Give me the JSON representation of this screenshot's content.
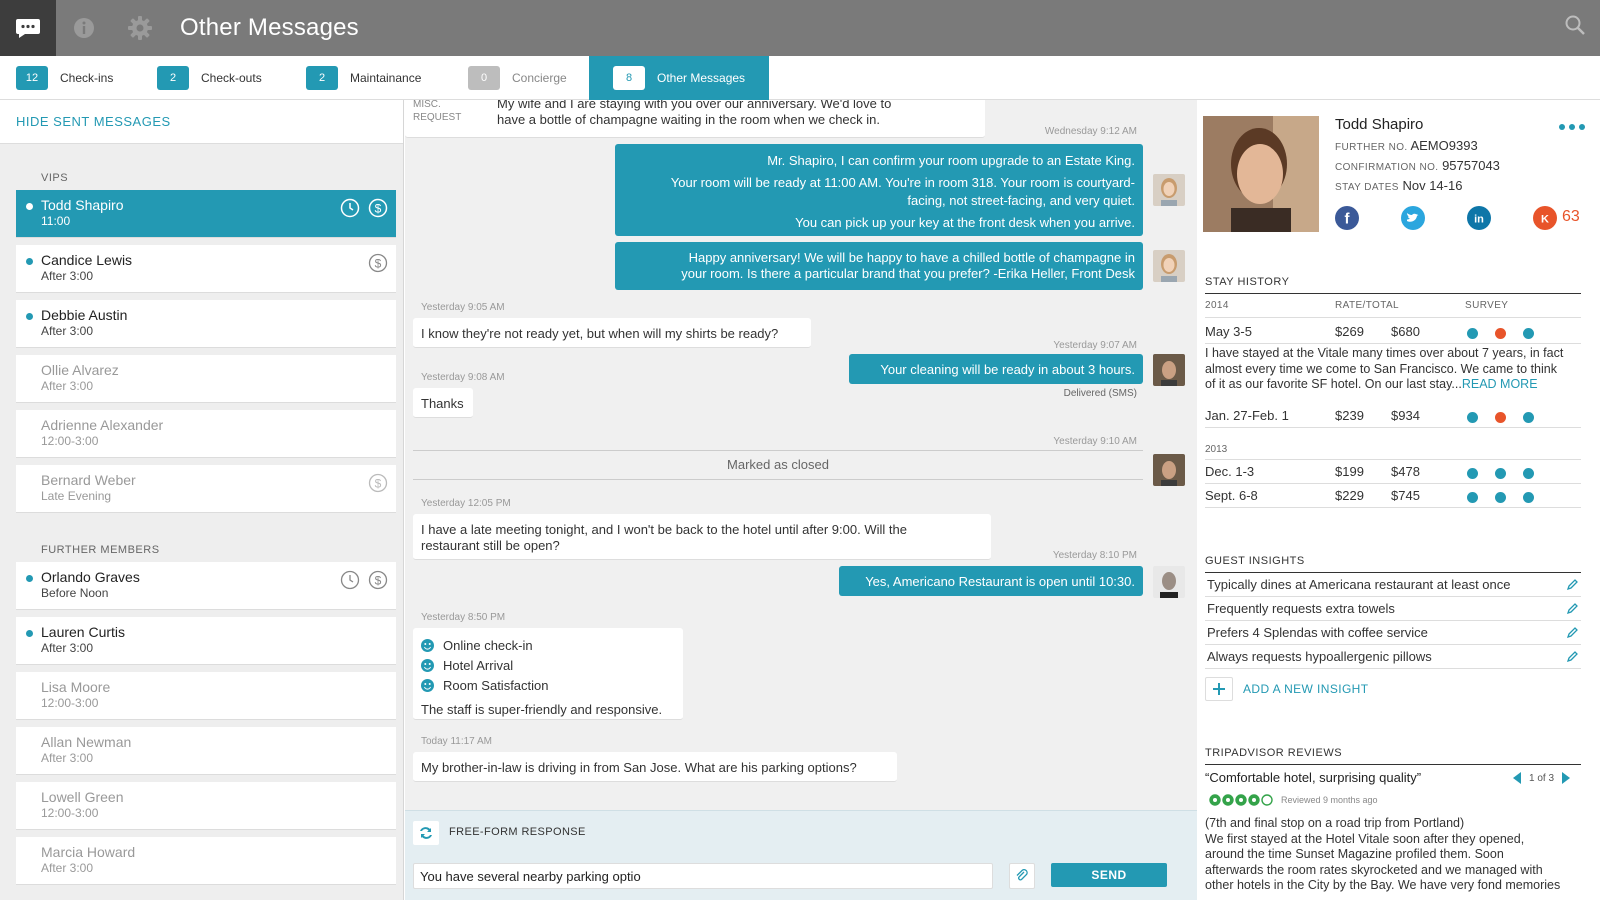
{
  "header": {
    "title": "Other Messages"
  },
  "tabs": [
    {
      "count": "12",
      "label": "Check-ins"
    },
    {
      "count": "2",
      "label": "Check-outs"
    },
    {
      "count": "2",
      "label": "Maintainance"
    },
    {
      "count": "0",
      "label": "Concierge"
    },
    {
      "count": "8",
      "label": "Other Messages"
    }
  ],
  "sidebar": {
    "hide_sent": "HIDE SENT MESSAGES",
    "vips_header": "VIPS",
    "members_header": "FURTHER MEMBERS",
    "vips": [
      {
        "name": "Todd Shapiro",
        "time": "11:00"
      },
      {
        "name": "Candice Lewis",
        "time": "After 3:00"
      },
      {
        "name": "Debbie Austin",
        "time": "After 3:00"
      },
      {
        "name": "Ollie Alvarez",
        "time": "After 3:00"
      },
      {
        "name": "Adrienne Alexander",
        "time": "12:00-3:00"
      },
      {
        "name": "Bernard Weber",
        "time": "Late Evening"
      }
    ],
    "members": [
      {
        "name": "Orlando Graves",
        "time": "Before Noon"
      },
      {
        "name": "Lauren Curtis",
        "time": "After 3:00"
      },
      {
        "name": "Lisa Moore",
        "time": "12:00-3:00"
      },
      {
        "name": "Allan Newman",
        "time": "After 3:00"
      },
      {
        "name": "Lowell Green",
        "time": "12:00-3:00"
      },
      {
        "name": "Marcia Howard",
        "time": "After 3:00"
      }
    ]
  },
  "chat": {
    "misc_label1": "MISC.",
    "misc_label2": "REQUEST",
    "m0a": "My wife and I are staying with you over our anniversary. We'd love to",
    "m0b": "have a bottle of champagne waiting in the room when we check in.",
    "ts1": "Wednesday 9:12 AM",
    "o1a": "Mr. Shapiro, I can confirm your room upgrade to an Estate King.",
    "o1b": "Your room will be ready at 11:00 AM. You're in room 318. Your room is courtyard-",
    "o1c": "facing, not street-facing, and very quiet.",
    "o1d": "You can pick up your key at the front desk when you arrive.",
    "o2a": "Happy anniversary! We will be happy to have a chilled bottle of champagne in",
    "o2b": "your room. Is there a particular brand that you prefer? -Erika Heller, Front Desk",
    "ts2": "Yesterday 9:05 AM",
    "i1": "I know they're not ready yet, but when will my shirts be ready?",
    "ts3": "Yesterday 9:07 AM",
    "o3": "Your cleaning will be ready in about 3 hours.",
    "ts4": "Yesterday 9:08 AM",
    "delivered": "Delivered (SMS)",
    "i2": "Thanks",
    "ts5": "Yesterday 9:10 AM",
    "closed": "Marked as closed",
    "ts6": "Yesterday 12:05 PM",
    "i3a": "I have a late meeting tonight, and I won't be back to the hotel until after 9:00. Will the",
    "i3b": "restaurant still be open?",
    "ts7": "Yesterday 8:10 PM",
    "o4": "Yes, Americano Restaurant is open until 10:30.",
    "ts8": "Yesterday 8:50 PM",
    "s1": "Online check-in",
    "s2": "Hotel Arrival",
    "s3": "Room Satisfaction",
    "s4": "The staff is super-friendly and responsive.",
    "ts9": "Today 11:17 AM",
    "i4": "My brother-in-law is driving in from San Jose. What are his parking options?",
    "composer_mode": "FREE-FORM RESPONSE",
    "composer_value": "You have several nearby parking optio",
    "send": "SEND"
  },
  "guest": {
    "name": "Todd Shapiro",
    "further_label": "FURTHER NO.",
    "further": "AEMO9393",
    "conf_label": "CONFIRMATION NO.",
    "conf": "95757043",
    "stay_label": "STAY DATES",
    "stay": "Nov 14-16",
    "klout": "63"
  },
  "history": {
    "header": "STAY HISTORY",
    "y2014": "2014",
    "rate_hdr": "RATE/TOTAL",
    "survey_hdr": "SURVEY",
    "r1": {
      "dates": "May 3-5",
      "rate": "$269",
      "total": "$680"
    },
    "review_a": "I have stayed at the Vitale many times over about 7 years, in fact",
    "review_b": "almost every time we come to San Francisco. We came to think",
    "review_c": "of it as our favorite SF hotel. On our last stay...",
    "read_more": "READ MORE",
    "r2": {
      "dates": "Jan. 27-Feb. 1",
      "rate": "$239",
      "total": "$934"
    },
    "y2013": "2013",
    "r3": {
      "dates": "Dec. 1-3",
      "rate": "$199",
      "total": "$478"
    },
    "r4": {
      "dates": "Sept. 6-8",
      "rate": "$229",
      "total": "$745"
    }
  },
  "insights": {
    "header": "GUEST INSIGHTS",
    "items": [
      "Typically dines at Americana restaurant at least once",
      "Frequently requests extra towels",
      "Prefers 4 Splendas with coffee service",
      "Always requests hypoallergenic pillows"
    ],
    "add": "ADD A NEW INSIGHT"
  },
  "trip": {
    "header": "TRIPADVISOR REVIEWS",
    "title": "“Comfortable hotel, surprising quality”",
    "pager": "1 of 3",
    "reviewed": "Reviewed 9 months ago",
    "rating": 4,
    "body": [
      "(7th and final stop on a road trip from Portland)",
      "We first stayed at the Hotel Vitale soon after they opened,",
      "around the time Sunset Magazine profiled them. Soon",
      "afterwards the room rates skyrocketed and we managed with",
      "other hotels in the City by the Bay. We have very fond memories"
    ]
  },
  "colors": {
    "accent": "#2399b3",
    "topbar": "#7a7a7a",
    "bad": "#e8542a"
  }
}
